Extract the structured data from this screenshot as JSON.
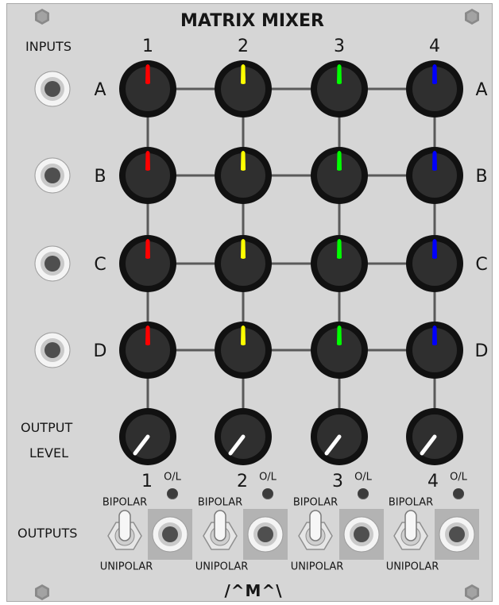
{
  "module": {
    "title": "MATRIX MIXER",
    "inputs_label": "INPUTS",
    "outputs_label": "OUTPUTS",
    "output_level_line1": "OUTPUT",
    "output_level_line2": "LEVEL",
    "logo": "/^M^\\"
  },
  "columns": [
    {
      "label": "1",
      "color": "#ff0000"
    },
    {
      "label": "2",
      "color": "#ffff00"
    },
    {
      "label": "3",
      "color": "#00ff00"
    },
    {
      "label": "4",
      "color": "#0000ff"
    }
  ],
  "rows": [
    {
      "label_left": "A",
      "label_right": "A"
    },
    {
      "label_left": "B",
      "label_right": "B"
    },
    {
      "label_left": "C",
      "label_right": "C"
    },
    {
      "label_left": "D",
      "label_right": "D"
    }
  ],
  "outputs": [
    {
      "label": "1",
      "overload_label": "O/L",
      "top_label": "BIPOLAR",
      "bottom_label": "UNIPOLAR"
    },
    {
      "label": "2",
      "overload_label": "O/L",
      "top_label": "BIPOLAR",
      "bottom_label": "UNIPOLAR"
    },
    {
      "label": "3",
      "overload_label": "O/L",
      "top_label": "BIPOLAR",
      "bottom_label": "UNIPOLAR"
    },
    {
      "label": "4",
      "overload_label": "O/L",
      "top_label": "BIPOLAR",
      "bottom_label": "UNIPOLAR"
    }
  ],
  "icons": {
    "screw": "screw-icon",
    "input_jack": "jack-icon",
    "toggle": "toggle-switch-icon"
  }
}
